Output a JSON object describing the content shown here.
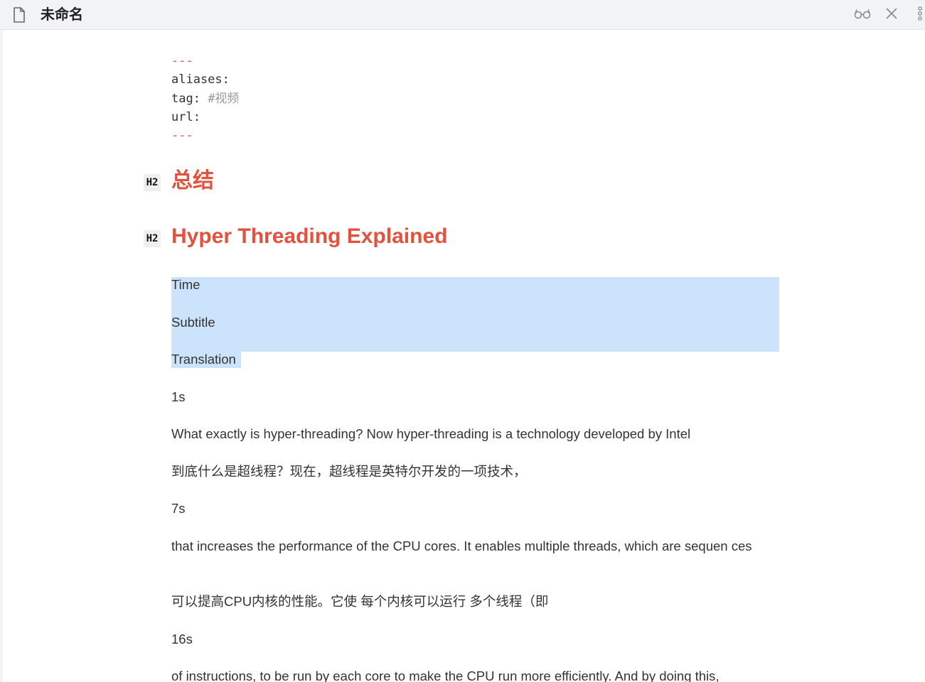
{
  "window": {
    "tab_title": "未命名",
    "icons": [
      "file-icon",
      "reading-mode-icon",
      "close-icon",
      "more-options-icon"
    ]
  },
  "frontmatter": {
    "open": "---",
    "aliases": "aliases:",
    "tag_key": "tag: ",
    "tag_value": "#视频",
    "url": "url:",
    "close": "---"
  },
  "headings": [
    {
      "badge": "H2",
      "text": "总结"
    },
    {
      "badge": "H2",
      "text": "Hyper Threading Explained"
    }
  ],
  "paragraphs": [
    "Time",
    "Subtitle",
    "Translation",
    "1s",
    "What exactly is hyper-threading? Now  hyper-threading is a technology developed by Intel",
    "到底什么是超线程？现在，超线程是英特尔开发的一项技术，",
    "7s",
    "that increases the performance of the CPU cores. It enables multiple threads, which are sequen ces",
    "可以提高CPU内核的性能。它使 每个内核可以运行 多个线程（即",
    "16s",
    "of instructions, to be run by each core to make  the CPU run more efficiently. And by doing this,"
  ],
  "colors": {
    "heading": "#e4523f",
    "selection": "#cce4fb",
    "frontmatter_dash": "#e05050",
    "tag": "#9a9a9a"
  }
}
